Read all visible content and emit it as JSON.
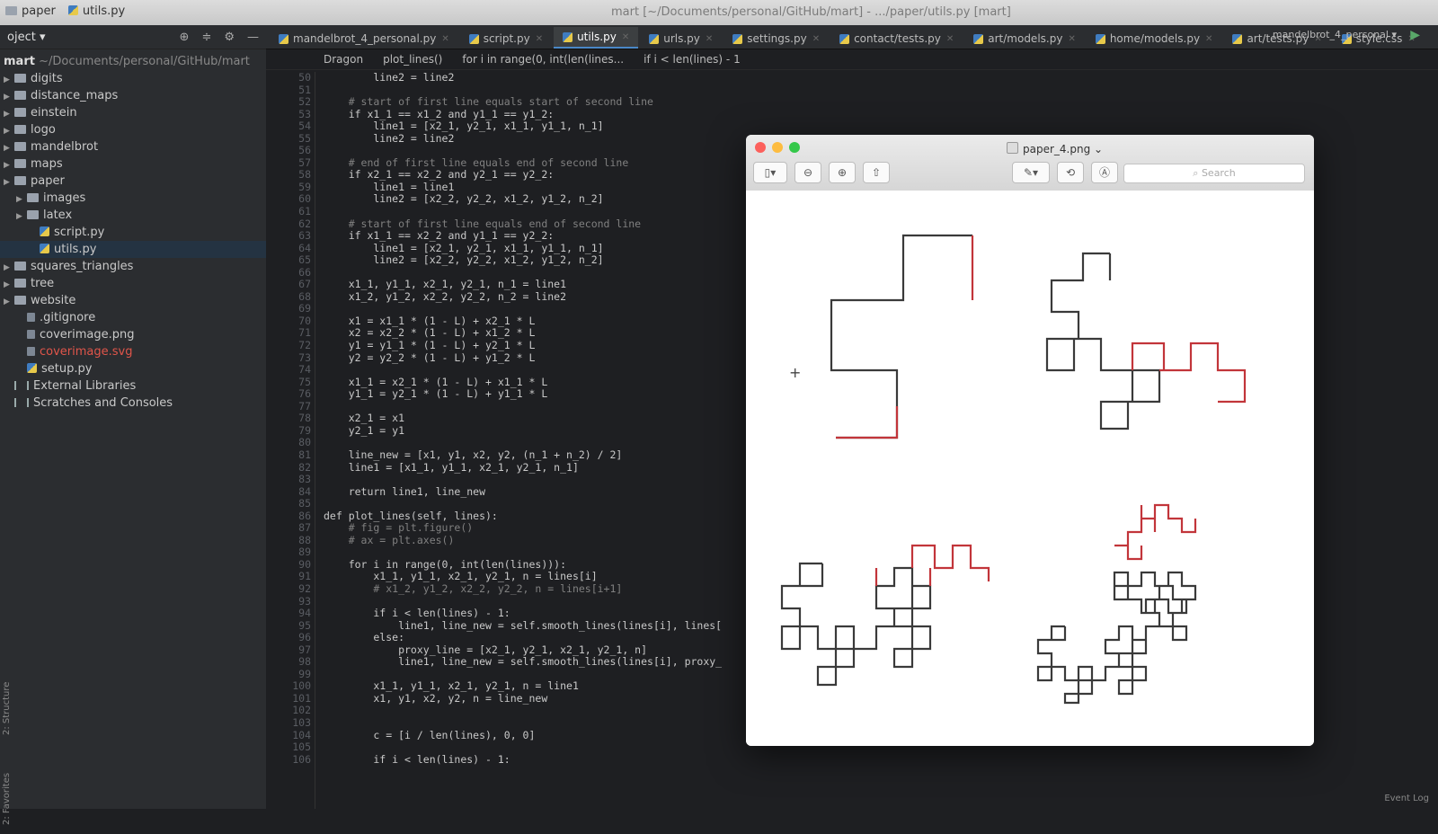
{
  "window": {
    "breadcrumb": [
      "paper",
      "utils.py"
    ],
    "title": "mart [~/Documents/personal/GitHub/mart] - .../paper/utils.py [mart]"
  },
  "project": {
    "header": "oject",
    "root_name": "mart",
    "root_path": "~/Documents/personal/GitHub/mart",
    "items": [
      {
        "label": "digits",
        "type": "folder",
        "depth": 0
      },
      {
        "label": "distance_maps",
        "type": "folder",
        "depth": 0
      },
      {
        "label": "einstein",
        "type": "folder",
        "depth": 0
      },
      {
        "label": "logo",
        "type": "folder",
        "depth": 0
      },
      {
        "label": "mandelbrot",
        "type": "folder",
        "depth": 0
      },
      {
        "label": "maps",
        "type": "folder",
        "depth": 0
      },
      {
        "label": "paper",
        "type": "folder",
        "depth": 0
      },
      {
        "label": "images",
        "type": "folder",
        "depth": 1
      },
      {
        "label": "latex",
        "type": "folder",
        "depth": 1
      },
      {
        "label": "script.py",
        "type": "py",
        "depth": 2
      },
      {
        "label": "utils.py",
        "type": "py",
        "depth": 2
      },
      {
        "label": "squares_triangles",
        "type": "folder",
        "depth": 0
      },
      {
        "label": "tree",
        "type": "folder",
        "depth": 0
      },
      {
        "label": "website",
        "type": "folder",
        "depth": 0
      },
      {
        "label": ".gitignore",
        "type": "file",
        "depth": 1
      },
      {
        "label": "coverimage.png",
        "type": "file",
        "depth": 1
      },
      {
        "label": "coverimage.svg",
        "type": "file",
        "depth": 1
      },
      {
        "label": "setup.py",
        "type": "py",
        "depth": 1
      },
      {
        "label": "External Libraries",
        "type": "lib",
        "depth": 0
      },
      {
        "label": "Scratches and Consoles",
        "type": "lib",
        "depth": 0
      }
    ],
    "side_labels": [
      "2: Structure",
      "2: Favorites"
    ]
  },
  "editor": {
    "tabs": [
      "mandelbrot_4_personal.py",
      "script.py",
      "utils.py",
      "urls.py",
      "settings.py",
      "contact/tests.py",
      "art/models.py",
      "home/models.py",
      "art/tests.py",
      "style.css"
    ],
    "active_tab": "utils.py",
    "run_config": "mandelbrot_4_personal",
    "breadcrumb": [
      "Dragon",
      "plot_lines()",
      "for i in range(0, int(len(lines...",
      "if i < len(lines) - 1"
    ],
    "line_start": 50,
    "code": [
      "        line2 = line2",
      "",
      "    # start of first line equals start of second line",
      "    if x1_1 == x1_2 and y1_1 == y1_2:",
      "        line1 = [x2_1, y2_1, x1_1, y1_1, n_1]",
      "        line2 = line2",
      "",
      "    # end of first line equals end of second line",
      "    if x2_1 == x2_2 and y2_1 == y2_2:",
      "        line1 = line1",
      "        line2 = [x2_2, y2_2, x1_2, y1_2, n_2]",
      "",
      "    # start of first line equals end of second line",
      "    if x1_1 == x2_2 and y1_1 == y2_2:",
      "        line1 = [x2_1, y2_1, x1_1, y1_1, n_1]",
      "        line2 = [x2_2, y2_2, x1_2, y1_2, n_2]",
      "",
      "    x1_1, y1_1, x2_1, y2_1, n_1 = line1",
      "    x1_2, y1_2, x2_2, y2_2, n_2 = line2",
      "",
      "    x1 = x1_1 * (1 - L) + x2_1 * L",
      "    x2 = x2_2 * (1 - L) + x1_2 * L",
      "    y1 = y1_1 * (1 - L) + y2_1 * L",
      "    y2 = y2_2 * (1 - L) + y1_2 * L",
      "",
      "    x1_1 = x2_1 * (1 - L) + x1_1 * L",
      "    y1_1 = y2_1 * (1 - L) + y1_1 * L",
      "",
      "    x2_1 = x1",
      "    y2_1 = y1",
      "",
      "    line_new = [x1, y1, x2, y2, (n_1 + n_2) / 2]",
      "    line1 = [x1_1, y1_1, x2_1, y2_1, n_1]",
      "",
      "    return line1, line_new",
      "",
      "def plot_lines(self, lines):",
      "    # fig = plt.figure()",
      "    # ax = plt.axes()",
      "",
      "    for i in range(0, int(len(lines))):",
      "        x1_1, y1_1, x2_1, y2_1, n = lines[i]",
      "        # x1_2, y1_2, x2_2, y2_2, n = lines[i+1]",
      "",
      "        if i < len(lines) - 1:",
      "            line1, line_new = self.smooth_lines(lines[i], lines[",
      "        else:",
      "            proxy_line = [x2_1, y2_1, x2_1, y2_1, n]",
      "            line1, line_new = self.smooth_lines(lines[i], proxy_",
      "",
      "        x1_1, y1_1, x2_1, y2_1, n = line1",
      "        x1, y1, x2, y2, n = line_new",
      "",
      "",
      "        c = [i / len(lines), 0, 0]",
      "",
      "        if i < len(lines) - 1:"
    ]
  },
  "preview": {
    "title": "paper_4.png",
    "search_placeholder": "Search",
    "colors": {
      "dark": "#3a3a3a",
      "red": "#c2353a"
    }
  },
  "status": {
    "event_log": "Event Log"
  }
}
